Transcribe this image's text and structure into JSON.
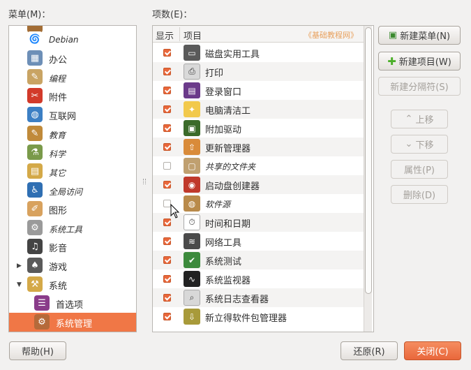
{
  "labels": {
    "menus": "菜单(M)：",
    "items": "项数(E)："
  },
  "columns": {
    "show": "显示",
    "item": "项目",
    "watermark": "《基础教程网》"
  },
  "menus": [
    {
      "label": "",
      "icon": "partial-top-icon",
      "italic": false
    },
    {
      "label": "Debian",
      "icon": "debian-icon",
      "italic": true
    },
    {
      "label": "办公",
      "icon": "office-icon",
      "italic": false
    },
    {
      "label": "编程",
      "icon": "programming-icon",
      "italic": true
    },
    {
      "label": "附件",
      "icon": "accessories-icon",
      "italic": false
    },
    {
      "label": "互联网",
      "icon": "internet-icon",
      "italic": false
    },
    {
      "label": "教育",
      "icon": "education-icon",
      "italic": true
    },
    {
      "label": "科学",
      "icon": "science-icon",
      "italic": true
    },
    {
      "label": "其它",
      "icon": "other-icon",
      "italic": true
    },
    {
      "label": "全局访问",
      "icon": "accessibility-icon",
      "italic": true
    },
    {
      "label": "图形",
      "icon": "graphics-icon",
      "italic": false
    },
    {
      "label": "系统工具",
      "icon": "system-tools-icon",
      "italic": true
    },
    {
      "label": "影音",
      "icon": "multimedia-icon",
      "italic": false
    },
    {
      "label": "游戏",
      "icon": "games-icon",
      "italic": false,
      "expander": "▶"
    },
    {
      "label": "系统",
      "icon": "system-icon",
      "italic": false,
      "expander": "▼"
    },
    {
      "label": "首选项",
      "icon": "preferences-icon",
      "italic": false
    },
    {
      "label": "系统管理",
      "icon": "administration-icon",
      "italic": false,
      "selected": true
    }
  ],
  "items": [
    {
      "label": "磁盘实用工具",
      "checked": true,
      "icon": "disk-utility-icon"
    },
    {
      "label": "打印",
      "checked": true,
      "icon": "printer-icon"
    },
    {
      "label": "登录窗口",
      "checked": true,
      "icon": "login-window-icon"
    },
    {
      "label": "电脑清洁工",
      "checked": true,
      "icon": "broom-icon"
    },
    {
      "label": "附加驱动",
      "checked": true,
      "icon": "driver-chip-icon"
    },
    {
      "label": "更新管理器",
      "checked": true,
      "icon": "update-manager-icon"
    },
    {
      "label": "共享的文件夹",
      "checked": false,
      "icon": "shared-folder-icon",
      "italic": true
    },
    {
      "label": "启动盘创建器",
      "checked": true,
      "icon": "startup-disk-icon"
    },
    {
      "label": "软件源",
      "checked": false,
      "icon": "software-sources-icon",
      "italic": true
    },
    {
      "label": "时间和日期",
      "checked": true,
      "icon": "clock-calendar-icon"
    },
    {
      "label": "网络工具",
      "checked": true,
      "icon": "network-tools-icon"
    },
    {
      "label": "系统测试",
      "checked": true,
      "icon": "system-testing-icon"
    },
    {
      "label": "系统监视器",
      "checked": true,
      "icon": "system-monitor-icon"
    },
    {
      "label": "系统日志查看器",
      "checked": true,
      "icon": "log-viewer-icon"
    },
    {
      "label": "新立得软件包管理器",
      "checked": true,
      "icon": "synaptic-icon"
    }
  ],
  "buttons": {
    "new_menu": "新建菜单(N)",
    "new_item": "新建项目(W)",
    "new_separator": "新建分隔符(S)",
    "move_up": "上移",
    "move_down": "下移",
    "properties": "属性(P)",
    "delete": "删除(D)",
    "help": "帮助(H)",
    "revert": "还原(R)",
    "close": "关闭(C)"
  },
  "colors": {
    "accent": "#f07746",
    "checkbox_on": "#e9673b"
  }
}
